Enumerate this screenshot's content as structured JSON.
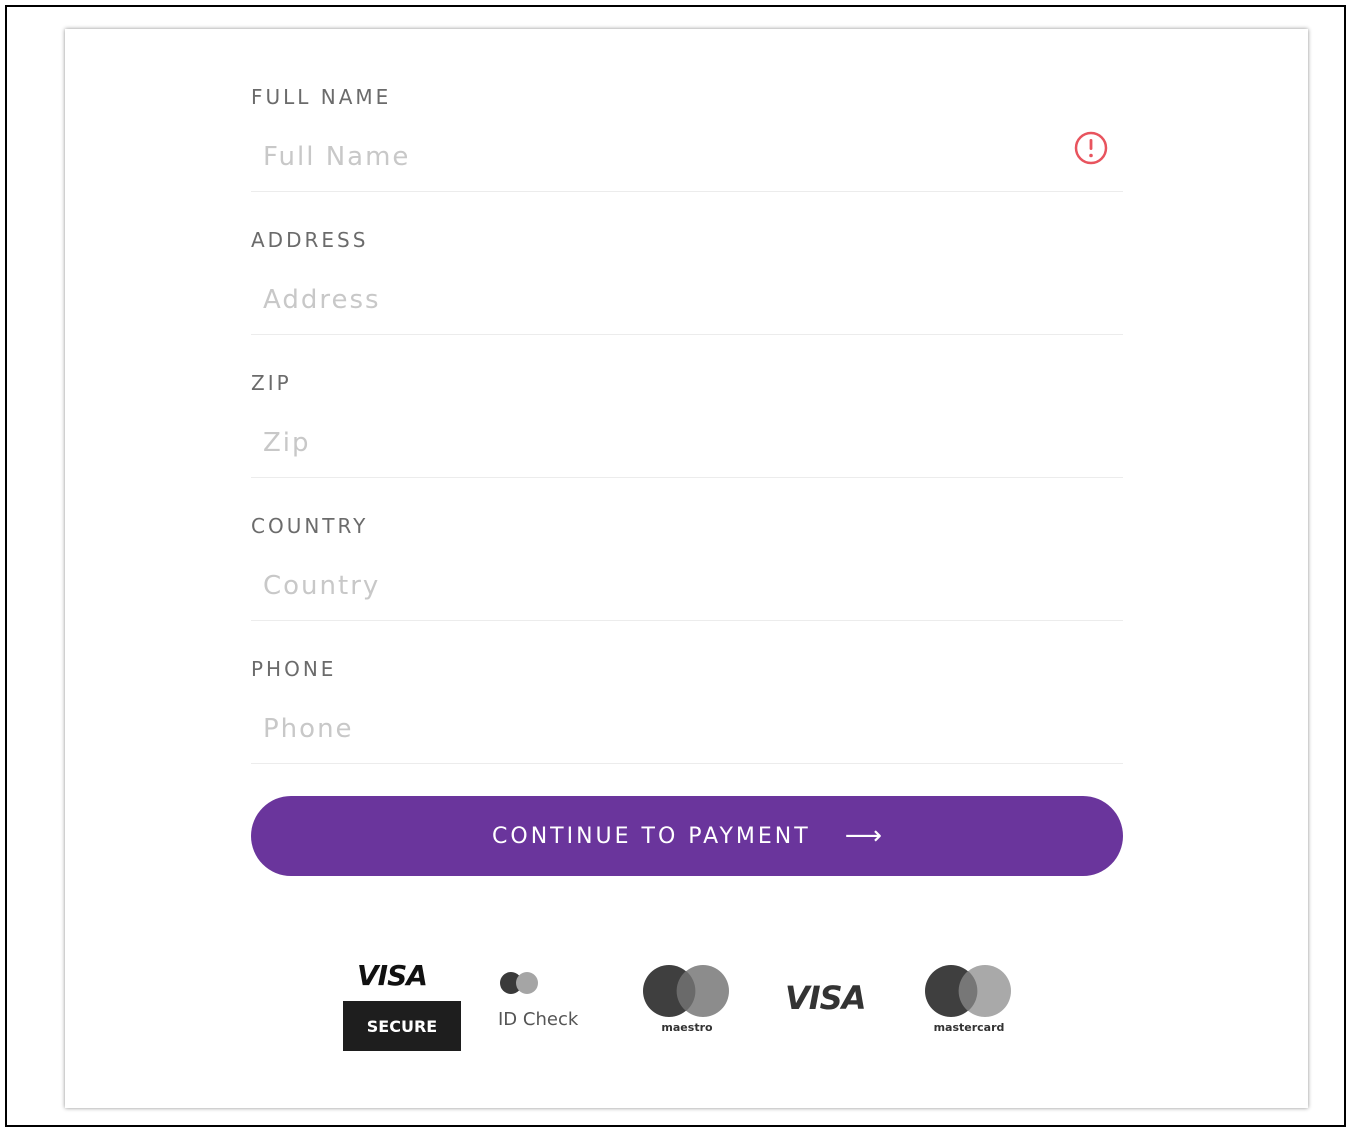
{
  "form": {
    "fields": [
      {
        "label": "FULL NAME",
        "placeholder": "Full Name",
        "value": "",
        "has_error": true
      },
      {
        "label": "ADDRESS",
        "placeholder": "Address",
        "value": "",
        "has_error": false
      },
      {
        "label": "ZIP",
        "placeholder": "Zip",
        "value": "",
        "has_error": false
      },
      {
        "label": "COUNTRY",
        "placeholder": "Country",
        "value": "",
        "has_error": false
      },
      {
        "label": "PHONE",
        "placeholder": "Phone",
        "value": "",
        "has_error": false
      }
    ],
    "submit_label": "CONTINUE TO PAYMENT",
    "submit_arrow": "⟶"
  },
  "payment_logos": {
    "visa_secure": {
      "top": "VISA",
      "bottom": "SECURE"
    },
    "id_check": {
      "label": "ID Check"
    },
    "maestro": {
      "label": "maestro"
    },
    "visa": {
      "label": "VISA"
    },
    "mastercard": {
      "label": "mastercard"
    }
  },
  "colors": {
    "accent": "#6a359c",
    "error": "#e8545e",
    "label": "#6b6b6b",
    "placeholder": "#c8c8c8"
  },
  "icons": {
    "error": "exclamation-circle-icon",
    "arrow": "arrow-right-icon"
  }
}
